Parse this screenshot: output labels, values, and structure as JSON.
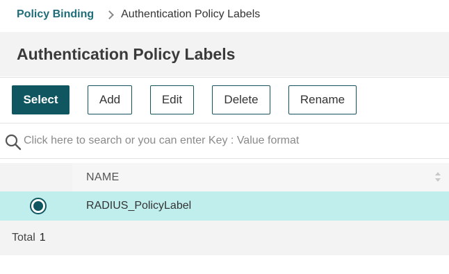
{
  "breadcrumb": {
    "parent": "Policy Binding",
    "current": "Authentication Policy Labels"
  },
  "page_title": "Authentication Policy Labels",
  "toolbar": {
    "select_label": "Select",
    "add_label": "Add",
    "edit_label": "Edit",
    "delete_label": "Delete",
    "rename_label": "Rename"
  },
  "search": {
    "placeholder": "Click here to search or you can enter Key : Value format",
    "value": ""
  },
  "table": {
    "columns": [
      "NAME"
    ],
    "rows": [
      {
        "name": "RADIUS_PolicyLabel",
        "selected": true
      }
    ]
  },
  "footer": {
    "total_label": "Total",
    "total_count": "1"
  },
  "colors": {
    "accent": "#0f5660",
    "link": "#1e6d79",
    "selected_row": "#bfeeed",
    "panel_bg": "#f3f3f3"
  },
  "icons": {
    "search": "search-icon",
    "breadcrumb_separator": "chevron-right-icon",
    "sort": "sort-icon"
  }
}
